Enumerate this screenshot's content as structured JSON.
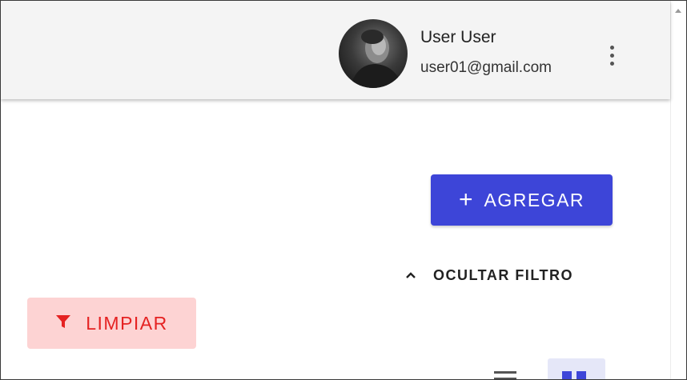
{
  "header": {
    "user_name": "User User",
    "user_email": "user01@gmail.com",
    "avatar_icon": "user-avatar",
    "menu_icon": "more-vertical-icon"
  },
  "actions": {
    "add_label": "AGREGAR",
    "add_icon": "plus-icon",
    "toggle_filter_label": "OCULTAR FILTRO",
    "toggle_filter_icon": "chevron-up-icon",
    "clear_label": "LIMPIAR",
    "clear_icon": "filter-icon"
  },
  "view_toggle": {
    "list_icon": "list-view-icon",
    "grid_icon": "grid-view-icon",
    "selected": "grid"
  },
  "colors": {
    "primary": "#3d45d8",
    "danger": "#e52222",
    "danger_bg": "#fdd3d3",
    "header_bg": "#f4f4f4"
  }
}
